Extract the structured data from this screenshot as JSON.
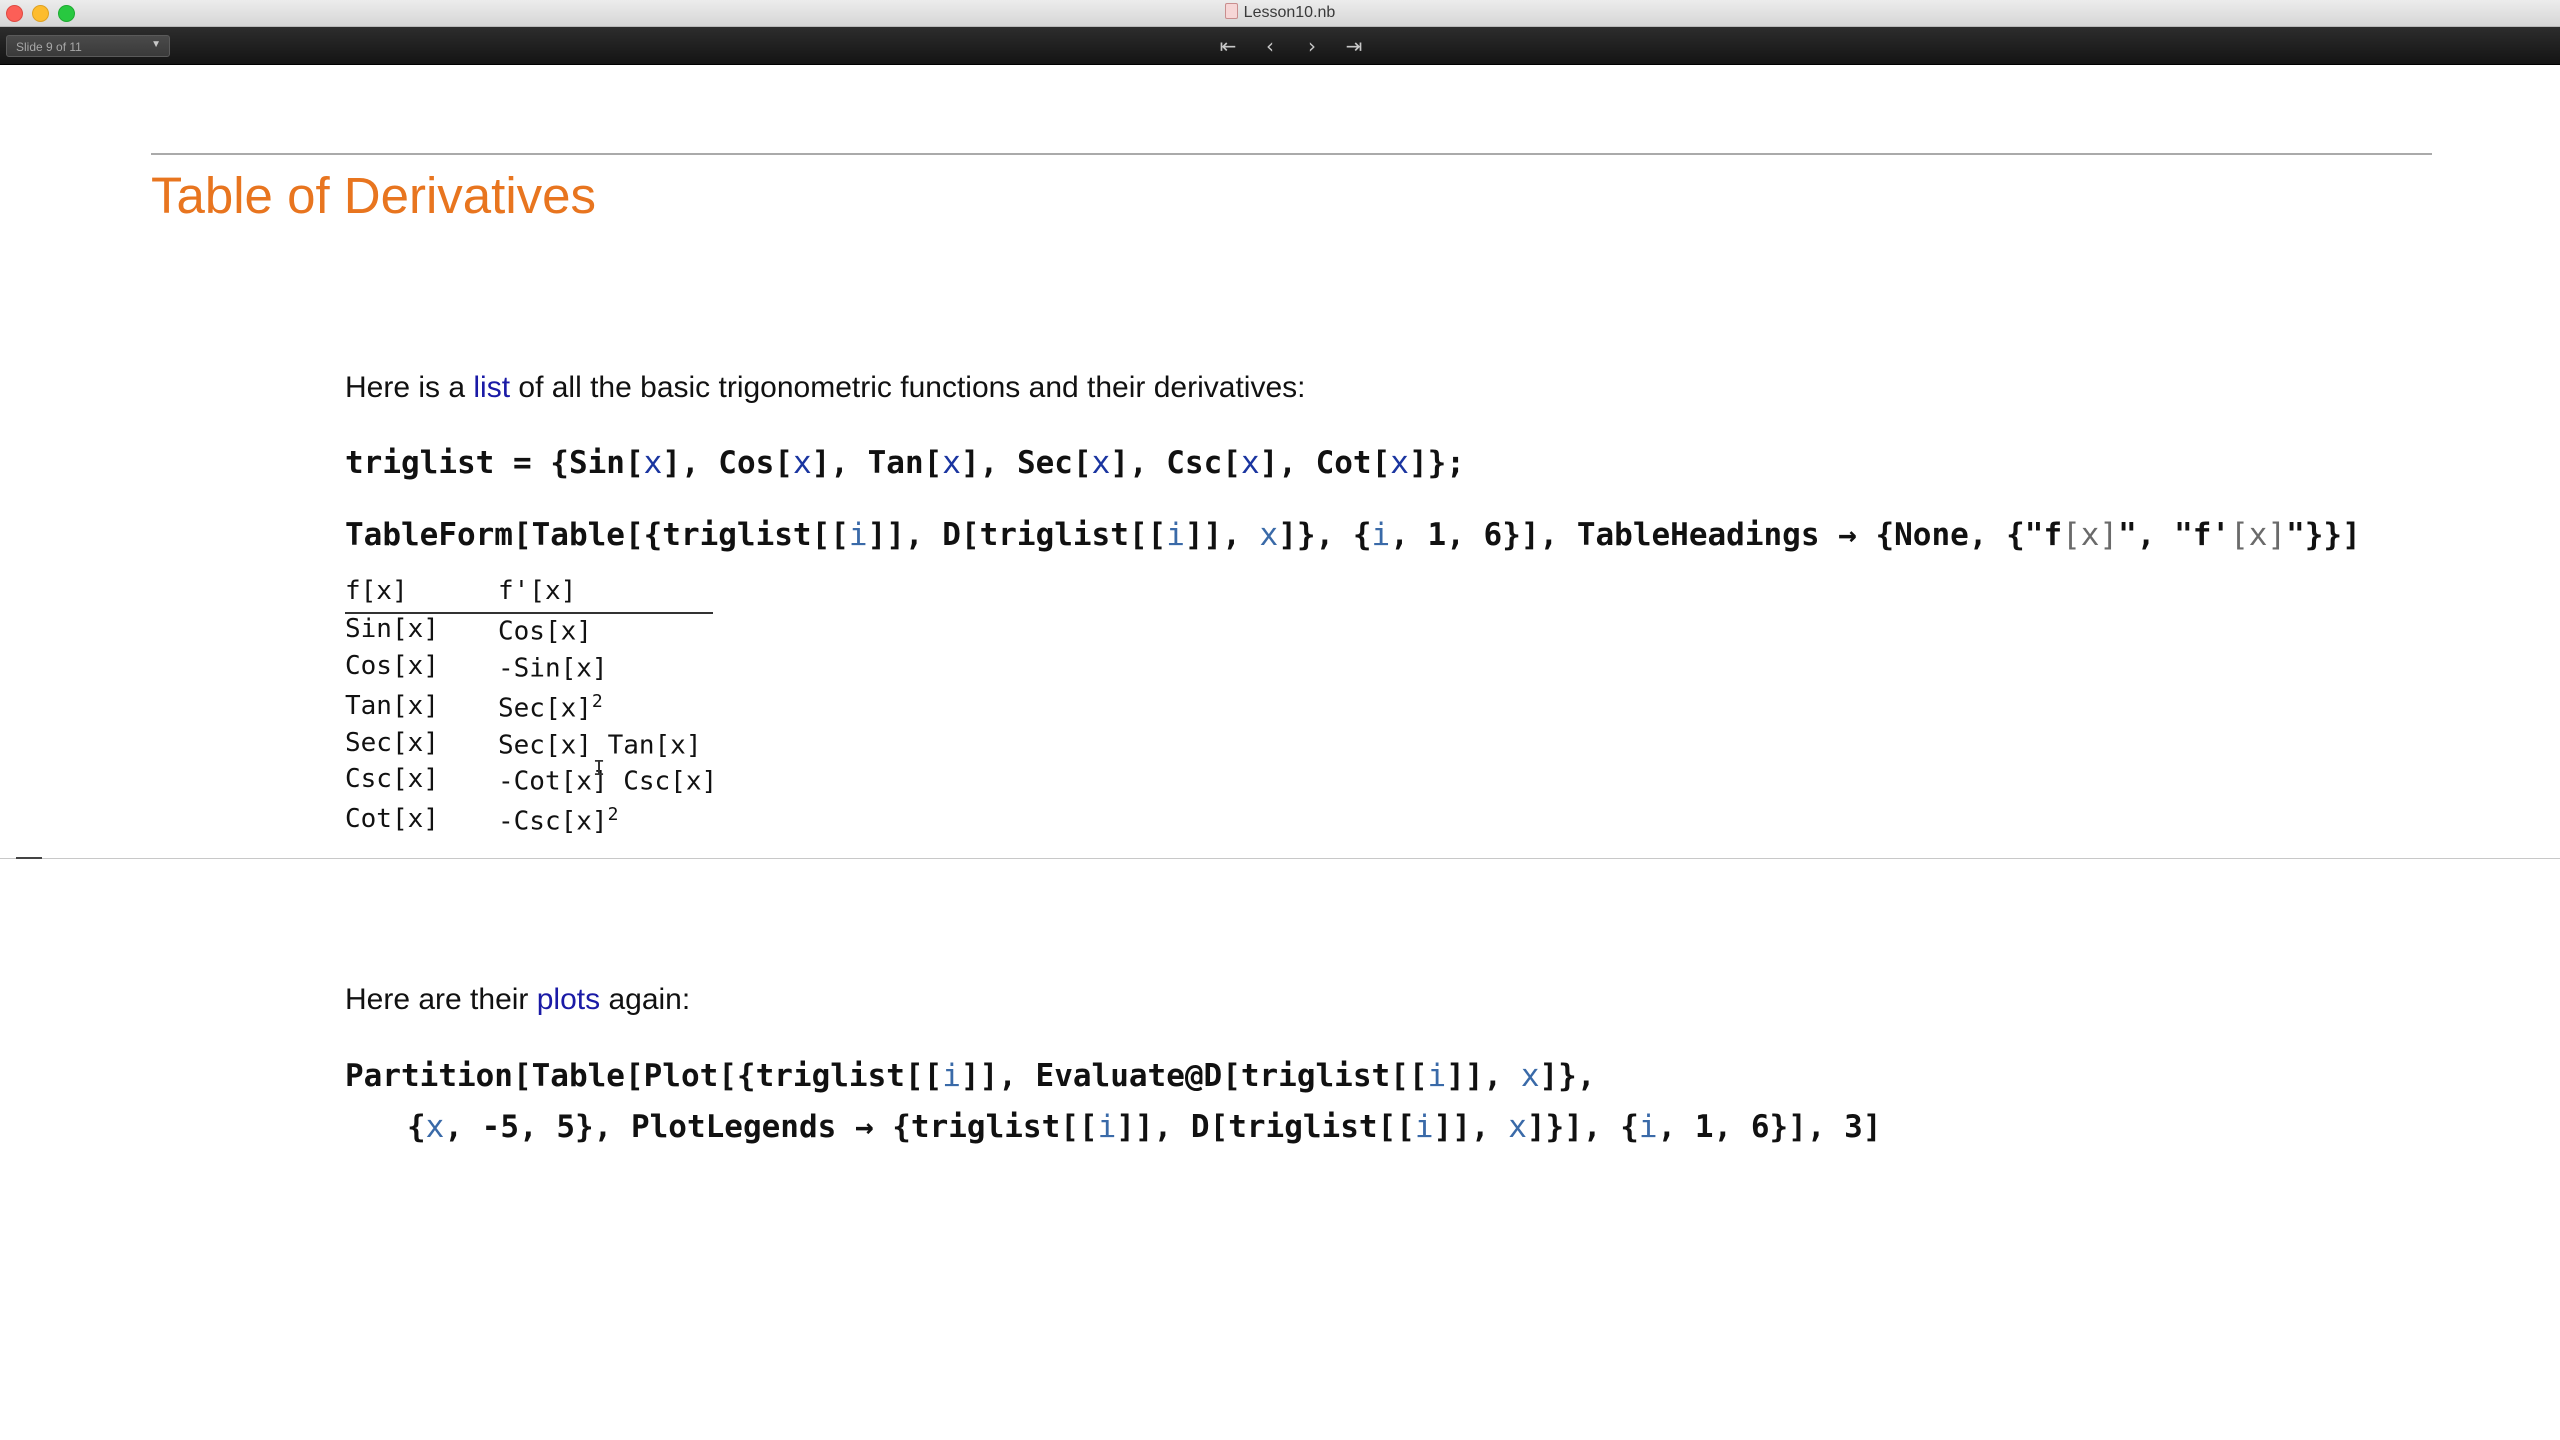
{
  "window": {
    "title": "Lesson10.nb"
  },
  "toolbar": {
    "slide_indicator": "Slide 9 of 11",
    "first_icon": "⇤",
    "prev_icon": "‹",
    "next_icon": "›",
    "last_icon": "⇥"
  },
  "slide": {
    "title": "Table of Derivatives",
    "intro": {
      "before": "Here is a ",
      "link": "list",
      "after": " of all the basic trigonometric functions and their derivatives:"
    },
    "plots_text": {
      "before": "Here are their ",
      "link": "plots",
      "after": " again:"
    }
  },
  "table": {
    "headers": [
      "f[x]",
      "f'[x]"
    ],
    "rows": [
      {
        "f": "Sin[x]",
        "d": "Cos[x]",
        "sup": ""
      },
      {
        "f": "Cos[x]",
        "d": "-Sin[x]",
        "sup": ""
      },
      {
        "f": "Tan[x]",
        "d": "Sec[x]",
        "sup": "2"
      },
      {
        "f": "Sec[x]",
        "d": "Sec[x] Tan[x]",
        "sup": ""
      },
      {
        "f": "Csc[x]",
        "d": "-Cot[x] Csc[x]",
        "sup": ""
      },
      {
        "f": "Cot[x]",
        "d": "-Csc[x]",
        "sup": "2"
      }
    ]
  },
  "colors": {
    "title": "#e8751f",
    "link": "#1a1aa6",
    "variable": "#3a6aa8"
  }
}
